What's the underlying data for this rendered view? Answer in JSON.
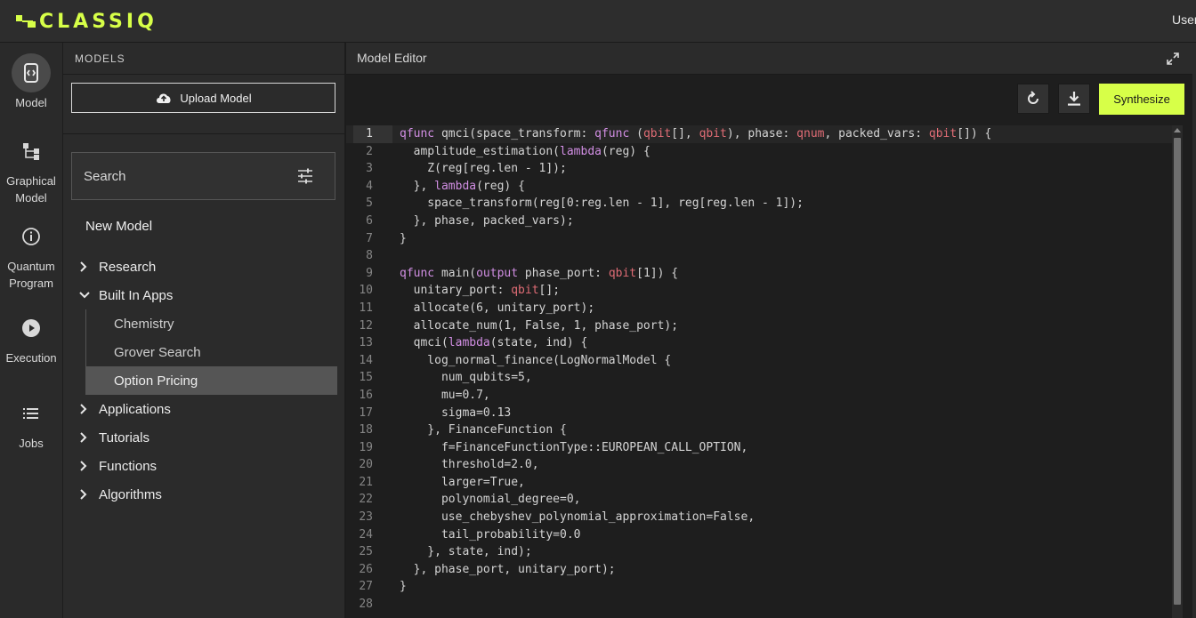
{
  "app": {
    "brand": "CLASSIQ",
    "user_label": "User",
    "accent": "#d7ff48"
  },
  "nav": [
    {
      "id": "model",
      "label": "Model",
      "icon": "model-icon",
      "active": true
    },
    {
      "id": "graphical",
      "label": "Graphical Model",
      "icon": "graph-icon"
    },
    {
      "id": "quantum",
      "label": "Quantum Program",
      "icon": "info-circle-icon"
    },
    {
      "id": "execution",
      "label": "Execution",
      "icon": "play-circle-icon"
    },
    {
      "id": "jobs",
      "label": "Jobs",
      "icon": "list-icon"
    }
  ],
  "models_panel": {
    "title": "MODELS",
    "upload_label": "Upload Model",
    "search_label": "Search",
    "new_model_label": "New Model",
    "tree": [
      {
        "label": "Research",
        "expanded": false
      },
      {
        "label": "Built In Apps",
        "expanded": true,
        "children": [
          "Chemistry",
          "Grover Search",
          "Option Pricing"
        ],
        "selected": "Option Pricing"
      },
      {
        "label": "Applications",
        "expanded": false
      },
      {
        "label": "Tutorials",
        "expanded": false
      },
      {
        "label": "Functions",
        "expanded": false
      },
      {
        "label": "Algorithms",
        "expanded": false
      }
    ]
  },
  "editor": {
    "title": "Model Editor",
    "synthesize_label": "Synthesize",
    "current_line": 1,
    "lines": [
      "qfunc qmci(space_transform: qfunc (qbit[], qbit), phase: qnum, packed_vars: qbit[]) {",
      "  amplitude_estimation(lambda(reg) {",
      "    Z(reg[reg.len - 1]);",
      "  }, lambda(reg) {",
      "    space_transform(reg[0:reg.len - 1], reg[reg.len - 1]);",
      "  }, phase, packed_vars);",
      "}",
      "",
      "qfunc main(output phase_port: qbit[1]) {",
      "  unitary_port: qbit[];",
      "  allocate(6, unitary_port);",
      "  allocate_num(1, False, 1, phase_port);",
      "  qmci(lambda(state, ind) {",
      "    log_normal_finance(LogNormalModel {",
      "      num_qubits=5,",
      "      mu=0.7,",
      "      sigma=0.13",
      "    }, FinanceFunction {",
      "      f=FinanceFunctionType::EUROPEAN_CALL_OPTION,",
      "      threshold=2.0,",
      "      larger=True,",
      "      polynomial_degree=0,",
      "      use_chebyshev_polynomial_approximation=False,",
      "      tail_probability=0.0",
      "    }, state, ind);",
      "  }, phase_port, unitary_port);",
      "}",
      ""
    ]
  }
}
